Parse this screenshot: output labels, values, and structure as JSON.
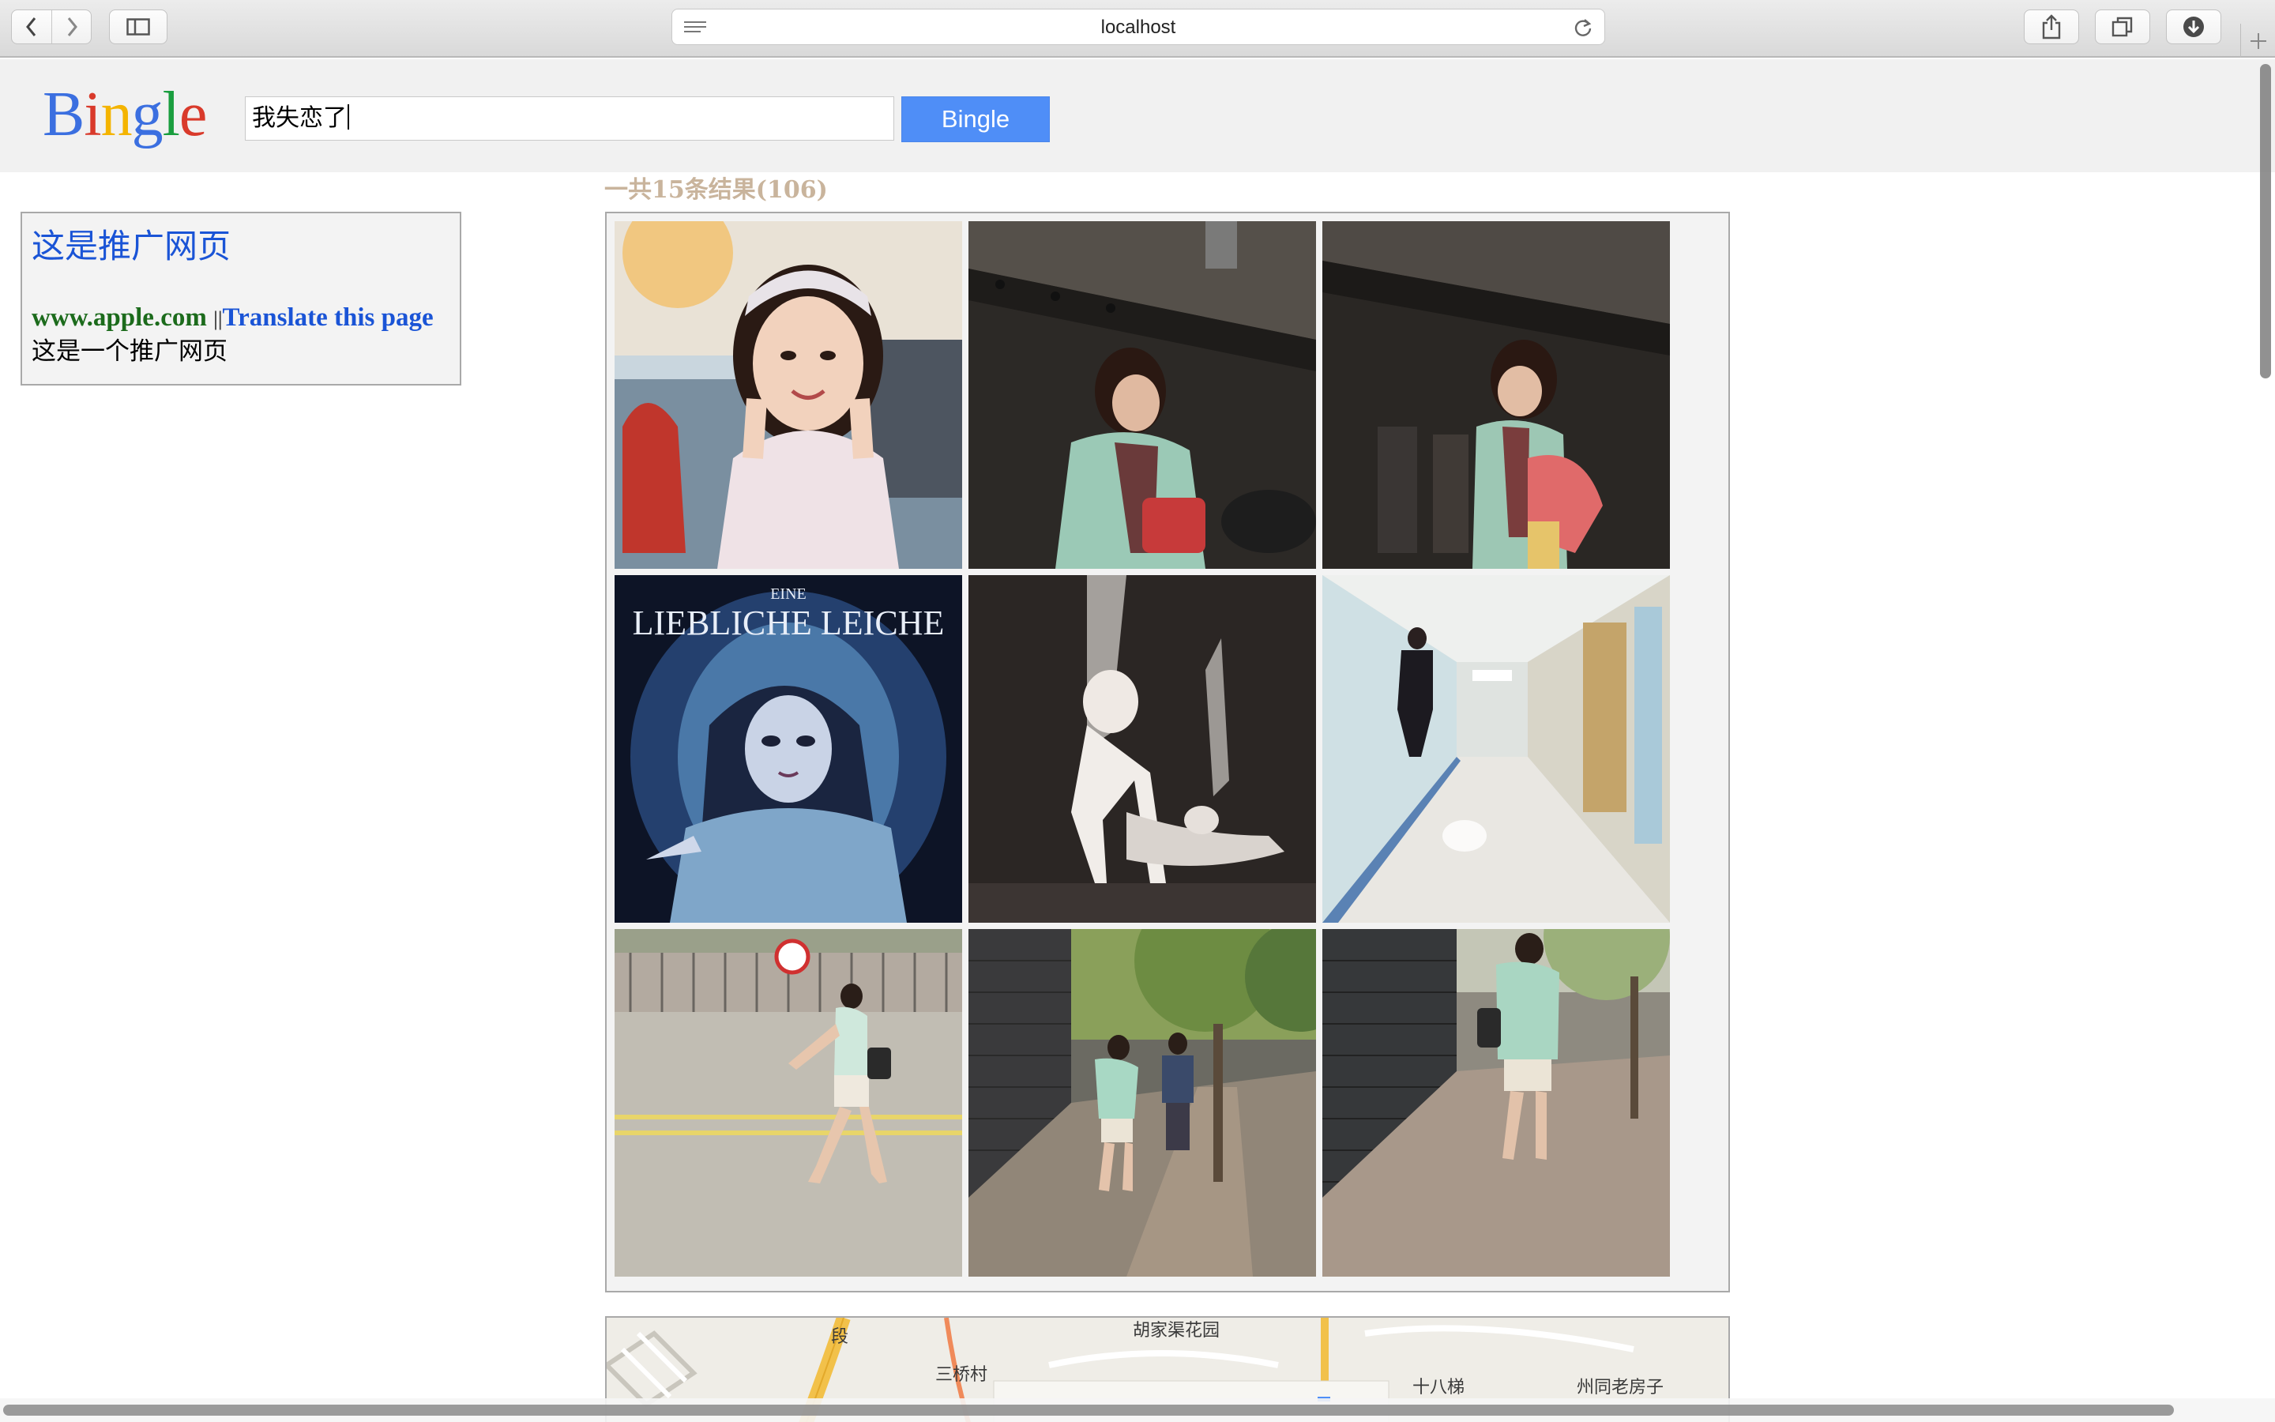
{
  "browser": {
    "address": "localhost",
    "icons": {
      "back": "chevron-left-icon",
      "forward": "chevron-right-icon",
      "sidebar": "sidebar-icon",
      "reader": "reader-icon",
      "reload": "reload-icon",
      "share": "share-icon",
      "tabs": "tabs-overview-icon",
      "downloads": "download-icon",
      "new_tab": "plus-icon"
    }
  },
  "header": {
    "logo_letters": [
      "B",
      "i",
      "n",
      "g",
      "l",
      "e"
    ],
    "logo_colors": [
      "#3b6fe0",
      "#d93a2b",
      "#f4b400",
      "#3b6fe0",
      "#1a9e3f",
      "#d93a2b"
    ],
    "search_query": "我失恋了",
    "search_button": "Bingle"
  },
  "ad": {
    "title": "这是推广网页",
    "url": "www.apple.com",
    "separator": "||",
    "translate": "Translate this page",
    "description": "这是一个推广网页"
  },
  "results": {
    "count_text": "一共15条结果(106)",
    "images": [
      {
        "desc": "smiling girl selfie in cafe",
        "theme": "cafe"
      },
      {
        "desc": "woman in mint jacket under metal structure",
        "theme": "dark"
      },
      {
        "desc": "woman with pink bag under metal structure",
        "theme": "dark"
      },
      {
        "desc": "Corpse Bride poster",
        "theme": "poster",
        "caption": "LIEBLICHE LEICHE",
        "caption_top": "EINE"
      },
      {
        "desc": "black and white dancers on stage",
        "theme": "bw"
      },
      {
        "desc": "hospital corridor with walking person",
        "theme": "corridor"
      },
      {
        "desc": "woman crossing street",
        "theme": "street"
      },
      {
        "desc": "couple on sidewalk by brick wall",
        "theme": "sidewalk"
      },
      {
        "desc": "woman walking on sidewalk by brick wall",
        "theme": "sidewalk"
      }
    ]
  },
  "map": {
    "labels": [
      "段",
      "胡家渠花园",
      "三桥村",
      "十八梯",
      "州同老房子"
    ]
  }
}
